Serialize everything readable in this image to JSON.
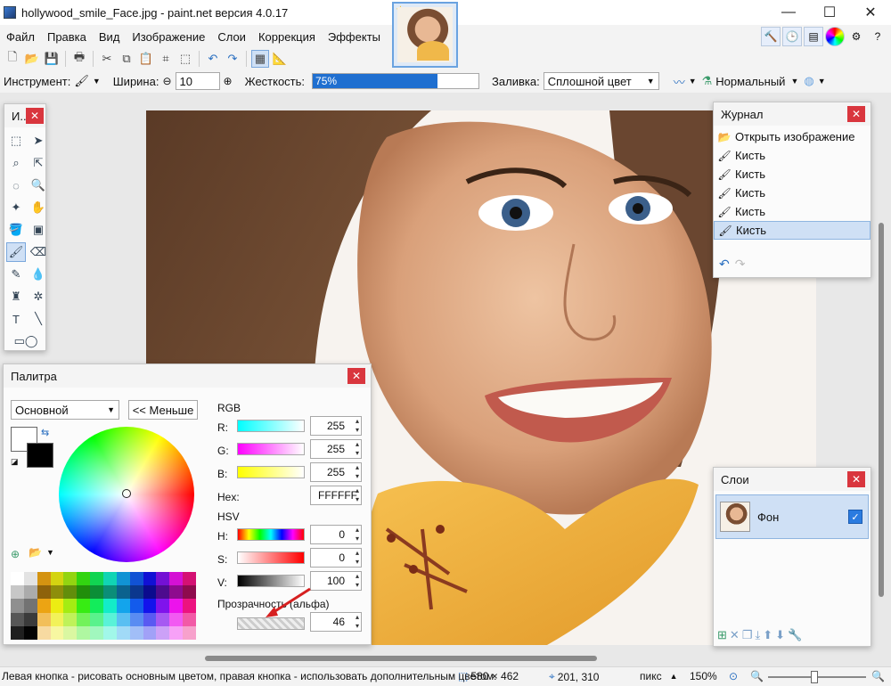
{
  "window": {
    "title": "hollywood_smile_Face.jpg - paint.net версия 4.0.17",
    "minimize": "—",
    "maximize": "☐",
    "close": "✕"
  },
  "menu": [
    "Файл",
    "Правка",
    "Вид",
    "Изображение",
    "Слои",
    "Коррекция",
    "Эффекты"
  ],
  "options": {
    "tool_label": "Инструмент:",
    "width_label": "Ширина:",
    "width_value": "10",
    "hardness_label": "Жесткость:",
    "hardness_value": "75%",
    "hardness_fraction": 0.75,
    "fill_label": "Заливка:",
    "fill_value": "Сплошной цвет",
    "blend_value": "Нормальный"
  },
  "tools_panel": {
    "title": "И..."
  },
  "palette": {
    "title": "Палитра",
    "mode": "Основной",
    "less_button": "<< Меньше",
    "rgb_label": "RGB",
    "r_label": "R:",
    "r_value": "255",
    "g_label": "G:",
    "g_value": "255",
    "b_label": "B:",
    "b_value": "255",
    "hex_label": "Hex:",
    "hex_value": "FFFFFF",
    "hsv_label": "HSV",
    "h_label": "H:",
    "h_value": "0",
    "s_label": "S:",
    "s_value": "0",
    "v_label": "V:",
    "v_value": "100",
    "alpha_label": "Прозрачность (альфа)",
    "alpha_value": "46"
  },
  "history": {
    "title": "Журнал",
    "items": [
      "Открыть изображение",
      "Кисть",
      "Кисть",
      "Кисть",
      "Кисть",
      "Кисть"
    ],
    "selected_index": 5
  },
  "layers": {
    "title": "Слои",
    "items": [
      "Фон"
    ]
  },
  "status": {
    "hint": "Левая кнопка - рисовать основным цветом, правая кнопка - использовать дополнительным цветом.",
    "image_size": "580 × 462",
    "cursor_pos": "201, 310",
    "units": "пикс",
    "zoom": "150%"
  },
  "colors": {
    "accent": "#1f6fd0",
    "close_red": "#d9363e",
    "selection": "#cfe0f5"
  }
}
